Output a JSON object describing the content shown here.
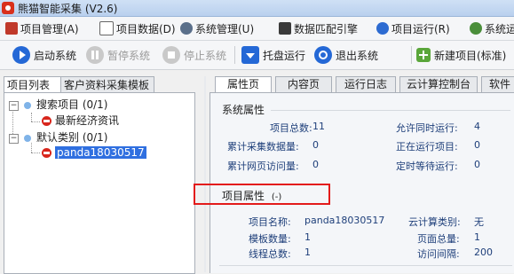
{
  "window": {
    "title": "熊猫智能采集 (V2.6)"
  },
  "menu": [
    {
      "label": "项目管理(A)",
      "icon": "project-icon"
    },
    {
      "label": "项目数据(D)",
      "icon": "data-icon"
    },
    {
      "label": "系统管理(U)",
      "icon": "gear-icon"
    },
    {
      "label": "数据匹配引擎",
      "icon": "engine-icon"
    },
    {
      "label": "项目运行(R)",
      "icon": "run-icon"
    },
    {
      "label": "系统运行",
      "icon": "system-run-icon"
    }
  ],
  "toolbar": {
    "start": "启动系统",
    "pause": "暂停系统",
    "stop": "停止系统",
    "tray": "托盘运行",
    "exit": "退出系统",
    "new_project": "新建项目(标准)"
  },
  "left_tabs": [
    "项目列表",
    "客户资料采集模板"
  ],
  "tree": {
    "group1": "搜索项目 (0/1)",
    "group1_child": "最新经济资讯",
    "group2": "默认类别 (0/1)",
    "group2_child": "panda18030517",
    "collapse_symbol": "−"
  },
  "right_tabs": [
    "属性页",
    "内容页",
    "运行日志",
    "云计算控制台",
    "软件"
  ],
  "system_props": {
    "title": "系统属性",
    "items": [
      {
        "label": "项目总数:",
        "value": "11"
      },
      {
        "label": "允许同时运行:",
        "value": "4"
      },
      {
        "label": "累计采集数据量:",
        "value": "0"
      },
      {
        "label": "正在运行项目:",
        "value": "0"
      },
      {
        "label": "累计网页访问量:",
        "value": "0"
      },
      {
        "label": "定时等待运行:",
        "value": "0"
      }
    ]
  },
  "project_props": {
    "title": "项目属性",
    "toggle": "(-)",
    "items": [
      {
        "label": "项目名称:",
        "value": "panda18030517"
      },
      {
        "label": "云计算类别:",
        "value": "无"
      },
      {
        "label": "模板数量:",
        "value": "1"
      },
      {
        "label": "页面总量:",
        "value": "1"
      },
      {
        "label": "线程总数:",
        "value": "1"
      },
      {
        "label": "访问间隔:",
        "value": "200"
      }
    ]
  },
  "colors": {
    "highlight": "#e31b1b",
    "selection": "#2f6fe0",
    "label_text": "#1e3f7a"
  }
}
